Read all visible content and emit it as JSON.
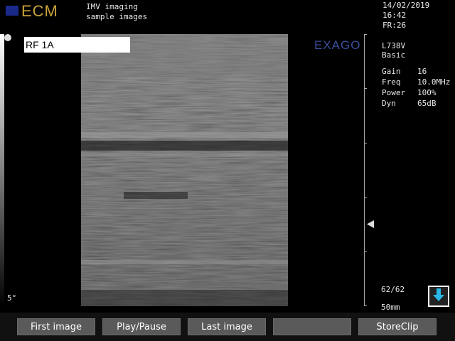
{
  "header": {
    "brand": "ECM",
    "line1": "IMV imaging",
    "line2": "sample images",
    "date": "14/02/2019",
    "time": "16:42",
    "frame_rate": "FR:26"
  },
  "image_label": "RF 1A",
  "watermark": "EXAGO",
  "probe": {
    "model": "L738V",
    "preset": "Basic"
  },
  "settings": [
    {
      "key": "Gain",
      "value": "16"
    },
    {
      "key": "Freq",
      "value": "10.0MHz"
    },
    {
      "key": "Power",
      "value": "100%"
    },
    {
      "key": "Dyn",
      "value": "65dB"
    }
  ],
  "angle": "5°",
  "frame_counter": "62/62",
  "depth": "50mm",
  "buttons": [
    {
      "label": "First image"
    },
    {
      "label": "Play/Pause"
    },
    {
      "label": "Last image"
    },
    {
      "label": ""
    },
    {
      "label": "StoreClip"
    }
  ],
  "colors": {
    "brand_gold": "#c8a23a",
    "brand_blue": "#1a2a8a",
    "watermark_blue": "#3b4f9e",
    "button_gray": "#5a5a5a"
  },
  "icons": {
    "store": "download-arrow-icon",
    "focus": "triangle-left-icon"
  }
}
